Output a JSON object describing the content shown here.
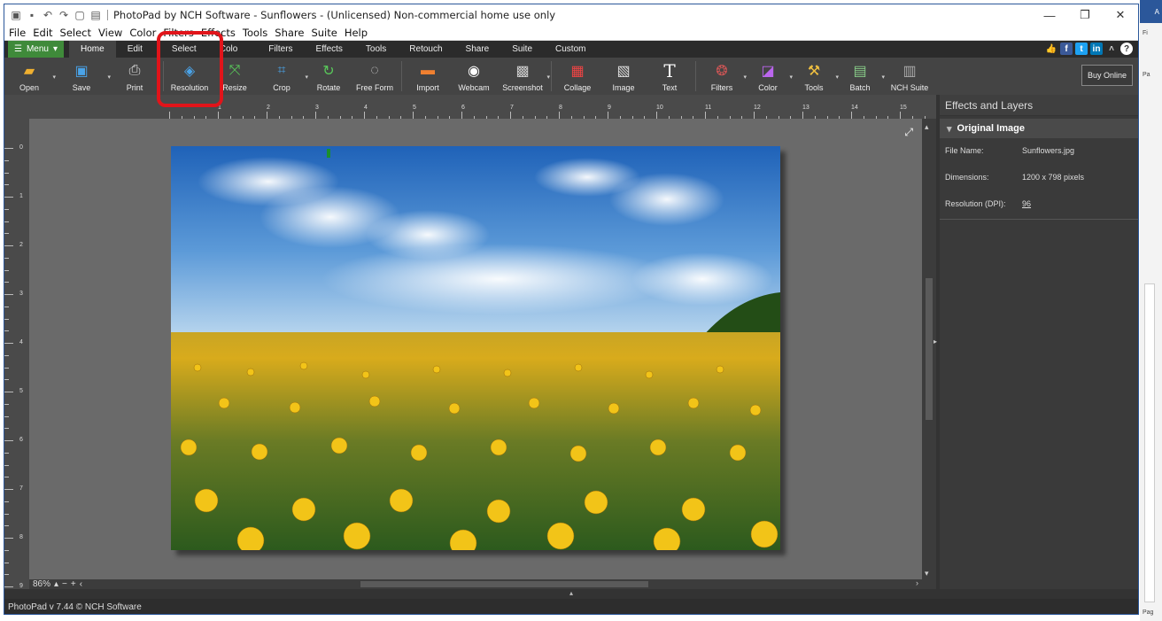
{
  "window": {
    "title": "PhotoPad by NCH Software - Sunflowers - (Unlicensed) Non-commercial home use only",
    "controls": [
      "—",
      "❐",
      "✕"
    ]
  },
  "menubar": [
    "File",
    "Edit",
    "Select",
    "View",
    "Color",
    "Filters",
    "Effects",
    "Tools",
    "Share",
    "Suite",
    "Help"
  ],
  "tabbar": {
    "menu_label": "Menu",
    "tabs": [
      "Home",
      "Edit",
      "Select",
      "Colo",
      "Filters",
      "Effects",
      "Tools",
      "Retouch",
      "Share",
      "Suite",
      "Custom"
    ],
    "active": "Home"
  },
  "toolbar": {
    "tools": [
      "Open",
      "Save",
      "Print",
      "Resolution",
      "Resize",
      "Crop",
      "Rotate",
      "Free Form",
      "Import",
      "Webcam",
      "Screenshot",
      "Collage",
      "Image",
      "Text",
      "Filters",
      "Color",
      "Tools",
      "Batch",
      "NCH Suite"
    ],
    "buy_label": "Buy Online"
  },
  "ruler": {
    "h_numbers": [
      "1",
      "2",
      "3",
      "4",
      "5",
      "6",
      "7",
      "8",
      "9",
      "10",
      "11",
      "12",
      "13",
      "14",
      "15"
    ],
    "v_numbers": [
      "0",
      "1",
      "2",
      "3",
      "4",
      "5",
      "6",
      "7",
      "8",
      "9"
    ]
  },
  "zoom": {
    "value": "86%"
  },
  "panel": {
    "title": "Effects and Layers",
    "section": "Original Image",
    "props": [
      {
        "key": "File Name:",
        "value": "Sunflowers.jpg"
      },
      {
        "key": "Dimensions:",
        "value": "1200 x 798 pixels"
      },
      {
        "key": "Resolution (DPI):",
        "value": "96"
      }
    ]
  },
  "status": {
    "text": "PhotoPad v 7.44 © NCH Software"
  },
  "background_app": {
    "tab_letter": "A",
    "label_fi": "Fi",
    "label_pa": "Pa",
    "label_pag": "Pag"
  },
  "colors": {
    "accent_green": "#3f8a3a",
    "highlight_red": "#e1141a",
    "title_blue": "#2b579a"
  }
}
